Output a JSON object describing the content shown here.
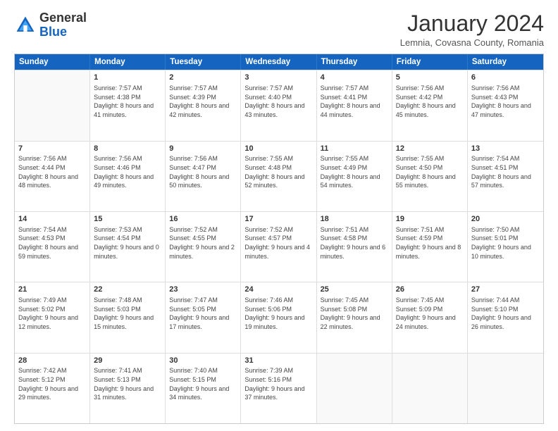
{
  "header": {
    "logo_general": "General",
    "logo_blue": "Blue",
    "month_title": "January 2024",
    "subtitle": "Lemnia, Covasna County, Romania"
  },
  "weekdays": [
    "Sunday",
    "Monday",
    "Tuesday",
    "Wednesday",
    "Thursday",
    "Friday",
    "Saturday"
  ],
  "rows": [
    [
      {
        "day": "",
        "sunrise": "",
        "sunset": "",
        "daylight": "",
        "empty": true
      },
      {
        "day": "1",
        "sunrise": "Sunrise: 7:57 AM",
        "sunset": "Sunset: 4:38 PM",
        "daylight": "Daylight: 8 hours and 41 minutes."
      },
      {
        "day": "2",
        "sunrise": "Sunrise: 7:57 AM",
        "sunset": "Sunset: 4:39 PM",
        "daylight": "Daylight: 8 hours and 42 minutes."
      },
      {
        "day": "3",
        "sunrise": "Sunrise: 7:57 AM",
        "sunset": "Sunset: 4:40 PM",
        "daylight": "Daylight: 8 hours and 43 minutes."
      },
      {
        "day": "4",
        "sunrise": "Sunrise: 7:57 AM",
        "sunset": "Sunset: 4:41 PM",
        "daylight": "Daylight: 8 hours and 44 minutes."
      },
      {
        "day": "5",
        "sunrise": "Sunrise: 7:56 AM",
        "sunset": "Sunset: 4:42 PM",
        "daylight": "Daylight: 8 hours and 45 minutes."
      },
      {
        "day": "6",
        "sunrise": "Sunrise: 7:56 AM",
        "sunset": "Sunset: 4:43 PM",
        "daylight": "Daylight: 8 hours and 47 minutes."
      }
    ],
    [
      {
        "day": "7",
        "sunrise": "Sunrise: 7:56 AM",
        "sunset": "Sunset: 4:44 PM",
        "daylight": "Daylight: 8 hours and 48 minutes."
      },
      {
        "day": "8",
        "sunrise": "Sunrise: 7:56 AM",
        "sunset": "Sunset: 4:46 PM",
        "daylight": "Daylight: 8 hours and 49 minutes."
      },
      {
        "day": "9",
        "sunrise": "Sunrise: 7:56 AM",
        "sunset": "Sunset: 4:47 PM",
        "daylight": "Daylight: 8 hours and 50 minutes."
      },
      {
        "day": "10",
        "sunrise": "Sunrise: 7:55 AM",
        "sunset": "Sunset: 4:48 PM",
        "daylight": "Daylight: 8 hours and 52 minutes."
      },
      {
        "day": "11",
        "sunrise": "Sunrise: 7:55 AM",
        "sunset": "Sunset: 4:49 PM",
        "daylight": "Daylight: 8 hours and 54 minutes."
      },
      {
        "day": "12",
        "sunrise": "Sunrise: 7:55 AM",
        "sunset": "Sunset: 4:50 PM",
        "daylight": "Daylight: 8 hours and 55 minutes."
      },
      {
        "day": "13",
        "sunrise": "Sunrise: 7:54 AM",
        "sunset": "Sunset: 4:51 PM",
        "daylight": "Daylight: 8 hours and 57 minutes."
      }
    ],
    [
      {
        "day": "14",
        "sunrise": "Sunrise: 7:54 AM",
        "sunset": "Sunset: 4:53 PM",
        "daylight": "Daylight: 8 hours and 59 minutes."
      },
      {
        "day": "15",
        "sunrise": "Sunrise: 7:53 AM",
        "sunset": "Sunset: 4:54 PM",
        "daylight": "Daylight: 9 hours and 0 minutes."
      },
      {
        "day": "16",
        "sunrise": "Sunrise: 7:52 AM",
        "sunset": "Sunset: 4:55 PM",
        "daylight": "Daylight: 9 hours and 2 minutes."
      },
      {
        "day": "17",
        "sunrise": "Sunrise: 7:52 AM",
        "sunset": "Sunset: 4:57 PM",
        "daylight": "Daylight: 9 hours and 4 minutes."
      },
      {
        "day": "18",
        "sunrise": "Sunrise: 7:51 AM",
        "sunset": "Sunset: 4:58 PM",
        "daylight": "Daylight: 9 hours and 6 minutes."
      },
      {
        "day": "19",
        "sunrise": "Sunrise: 7:51 AM",
        "sunset": "Sunset: 4:59 PM",
        "daylight": "Daylight: 9 hours and 8 minutes."
      },
      {
        "day": "20",
        "sunrise": "Sunrise: 7:50 AM",
        "sunset": "Sunset: 5:01 PM",
        "daylight": "Daylight: 9 hours and 10 minutes."
      }
    ],
    [
      {
        "day": "21",
        "sunrise": "Sunrise: 7:49 AM",
        "sunset": "Sunset: 5:02 PM",
        "daylight": "Daylight: 9 hours and 12 minutes."
      },
      {
        "day": "22",
        "sunrise": "Sunrise: 7:48 AM",
        "sunset": "Sunset: 5:03 PM",
        "daylight": "Daylight: 9 hours and 15 minutes."
      },
      {
        "day": "23",
        "sunrise": "Sunrise: 7:47 AM",
        "sunset": "Sunset: 5:05 PM",
        "daylight": "Daylight: 9 hours and 17 minutes."
      },
      {
        "day": "24",
        "sunrise": "Sunrise: 7:46 AM",
        "sunset": "Sunset: 5:06 PM",
        "daylight": "Daylight: 9 hours and 19 minutes."
      },
      {
        "day": "25",
        "sunrise": "Sunrise: 7:45 AM",
        "sunset": "Sunset: 5:08 PM",
        "daylight": "Daylight: 9 hours and 22 minutes."
      },
      {
        "day": "26",
        "sunrise": "Sunrise: 7:45 AM",
        "sunset": "Sunset: 5:09 PM",
        "daylight": "Daylight: 9 hours and 24 minutes."
      },
      {
        "day": "27",
        "sunrise": "Sunrise: 7:44 AM",
        "sunset": "Sunset: 5:10 PM",
        "daylight": "Daylight: 9 hours and 26 minutes."
      }
    ],
    [
      {
        "day": "28",
        "sunrise": "Sunrise: 7:42 AM",
        "sunset": "Sunset: 5:12 PM",
        "daylight": "Daylight: 9 hours and 29 minutes."
      },
      {
        "day": "29",
        "sunrise": "Sunrise: 7:41 AM",
        "sunset": "Sunset: 5:13 PM",
        "daylight": "Daylight: 9 hours and 31 minutes."
      },
      {
        "day": "30",
        "sunrise": "Sunrise: 7:40 AM",
        "sunset": "Sunset: 5:15 PM",
        "daylight": "Daylight: 9 hours and 34 minutes."
      },
      {
        "day": "31",
        "sunrise": "Sunrise: 7:39 AM",
        "sunset": "Sunset: 5:16 PM",
        "daylight": "Daylight: 9 hours and 37 minutes."
      },
      {
        "day": "",
        "sunrise": "",
        "sunset": "",
        "daylight": "",
        "empty": true
      },
      {
        "day": "",
        "sunrise": "",
        "sunset": "",
        "daylight": "",
        "empty": true
      },
      {
        "day": "",
        "sunrise": "",
        "sunset": "",
        "daylight": "",
        "empty": true
      }
    ]
  ]
}
